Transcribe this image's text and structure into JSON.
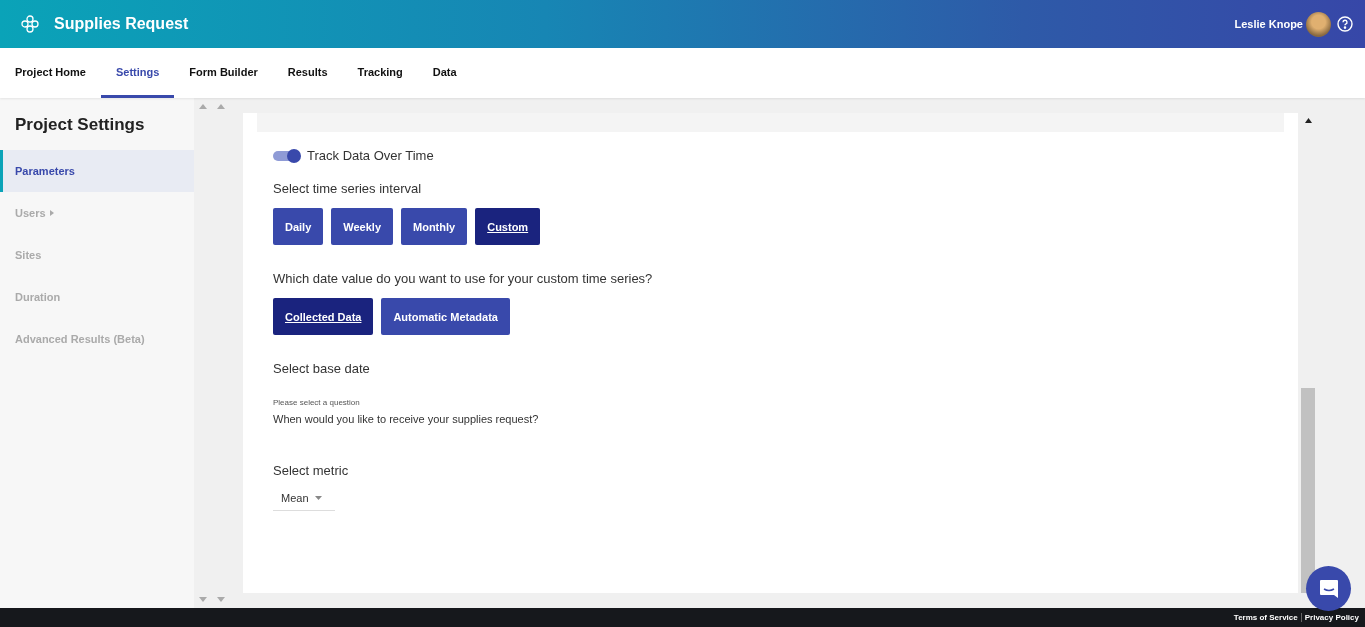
{
  "header": {
    "title": "Supplies Request",
    "user": "Leslie Knope"
  },
  "nav": [
    {
      "label": "Project Home",
      "selected": false
    },
    {
      "label": "Settings",
      "selected": true
    },
    {
      "label": "Form Builder",
      "selected": false
    },
    {
      "label": "Results",
      "selected": false
    },
    {
      "label": "Tracking",
      "selected": false
    },
    {
      "label": "Data",
      "selected": false
    }
  ],
  "sidebar": {
    "title": "Project Settings",
    "items": [
      {
        "label": "Parameters",
        "selected": true,
        "has_submenu": false
      },
      {
        "label": "Users",
        "selected": false,
        "has_submenu": true
      },
      {
        "label": "Sites",
        "selected": false,
        "has_submenu": false
      },
      {
        "label": "Duration",
        "selected": false,
        "has_submenu": false
      },
      {
        "label": "Advanced Results (Beta)",
        "selected": false,
        "has_submenu": false
      }
    ]
  },
  "settings": {
    "track_toggle": {
      "label": "Track Data Over Time",
      "on": true
    },
    "interval": {
      "label": "Select time series interval",
      "options": [
        {
          "label": "Daily",
          "selected": false
        },
        {
          "label": "Weekly",
          "selected": false
        },
        {
          "label": "Monthly",
          "selected": false
        },
        {
          "label": "Custom",
          "selected": true
        }
      ]
    },
    "date_value": {
      "label": "Which date value do you want to use for your custom time series?",
      "options": [
        {
          "label": "Collected Data",
          "selected": true
        },
        {
          "label": "Automatic Metadata",
          "selected": false
        }
      ]
    },
    "base_date": {
      "label": "Select base date",
      "hint": "Please select a question",
      "question": "When would you like to receive your supplies request?"
    },
    "metric": {
      "label": "Select metric",
      "value": "Mean"
    }
  },
  "footer": {
    "links": [
      "Terms of Service",
      "Privacy Policy"
    ]
  }
}
